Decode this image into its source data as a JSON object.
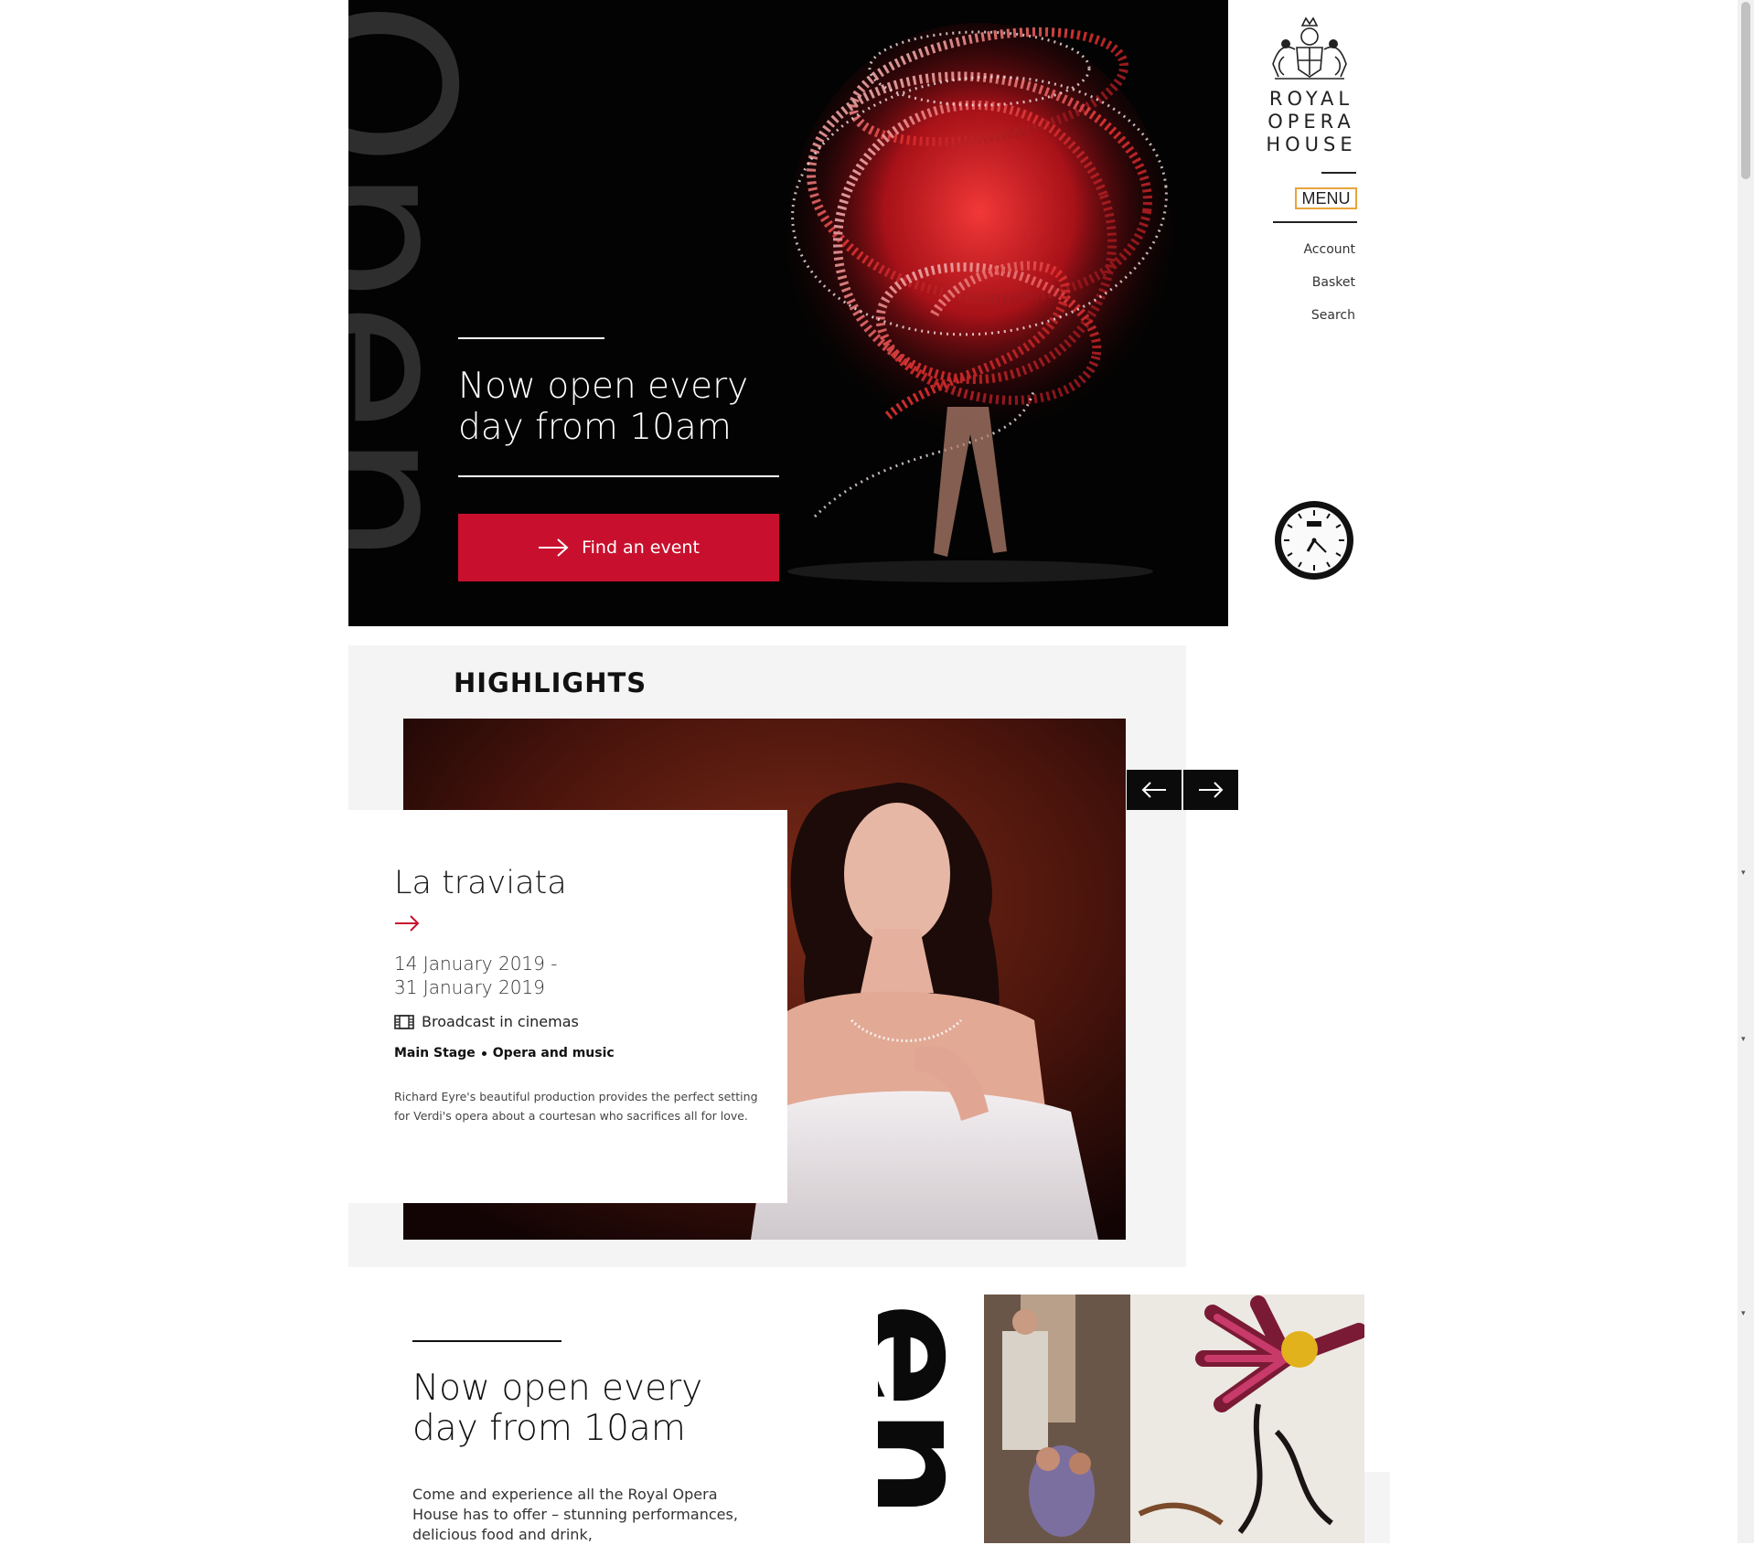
{
  "hero": {
    "side_word": "Open",
    "title": "Now open every day from 10am",
    "cta_label": "Find an event"
  },
  "header": {
    "logo_text": [
      "ROYAL",
      "OPERA",
      "HOUSE"
    ],
    "menu_label": "MENU",
    "links": [
      "Account",
      "Basket",
      "Search"
    ]
  },
  "highlights": {
    "title": "HIGHLIGHTS",
    "item": {
      "title": "La traviata",
      "date_start": "14 January 2019 -",
      "date_end": "31 January 2019",
      "broadcast": "Broadcast in cinemas",
      "venue": "Main Stage",
      "category": "Opera and music",
      "description": "Richard Eyre's beautiful production provides the perfect setting for Verdi's opera about a courtesan who sacrifices all for love."
    }
  },
  "lower": {
    "title": "Now open every day from 10am",
    "side_word": "en",
    "text": "Come and experience all the Royal Opera House has to offer – stunning performances, delicious food and drink,"
  },
  "colors": {
    "accent": "#c8102e",
    "hero_bg": "#030303",
    "panel_bg": "#f4f4f4",
    "menu_border": "#e8a33c"
  },
  "icons": {
    "cta": "arrow-right-icon",
    "prev": "arrow-left-icon",
    "next": "arrow-right-icon",
    "broadcast": "film-icon",
    "clock": "rolex-clock-icon",
    "logo": "royal-crest-icon"
  }
}
